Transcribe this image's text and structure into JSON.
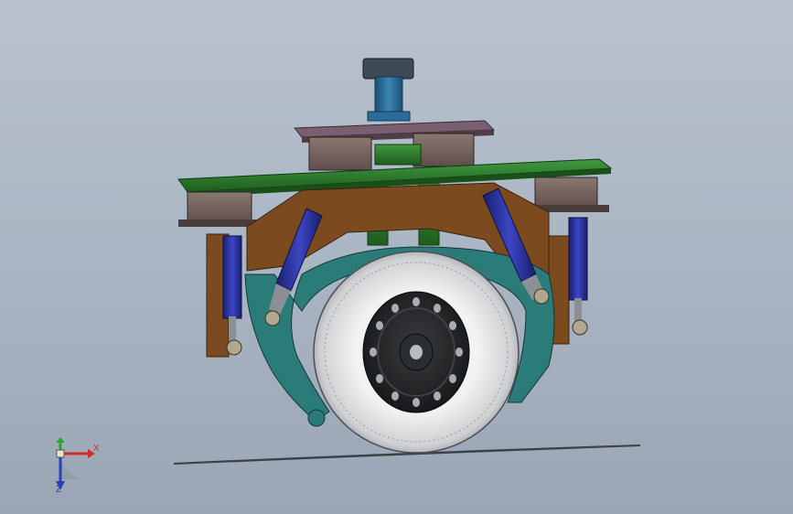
{
  "viewport": {
    "colors": {
      "bg_top": "#b9c3cf",
      "bg_bottom": "#9aa6b5"
    }
  },
  "model": {
    "description_icon": "cad-wheel-assembly",
    "colors": {
      "top_plate": "#6e5663",
      "mount_pad": "#6a5a58",
      "green_frame": "#2f7a2f",
      "brown_bracket": "#7a4a1e",
      "teal_arm": "#2c7f7a",
      "cylinder": "#27309a",
      "tire": "#d8d8d8",
      "rim": "#232527",
      "shaft": "#2f6d97"
    }
  },
  "triad": {
    "x_label": "X",
    "z_label": "Z",
    "colors": {
      "x": "#d42a2a",
      "y": "#2aa82a",
      "z": "#2a3fb8"
    }
  }
}
